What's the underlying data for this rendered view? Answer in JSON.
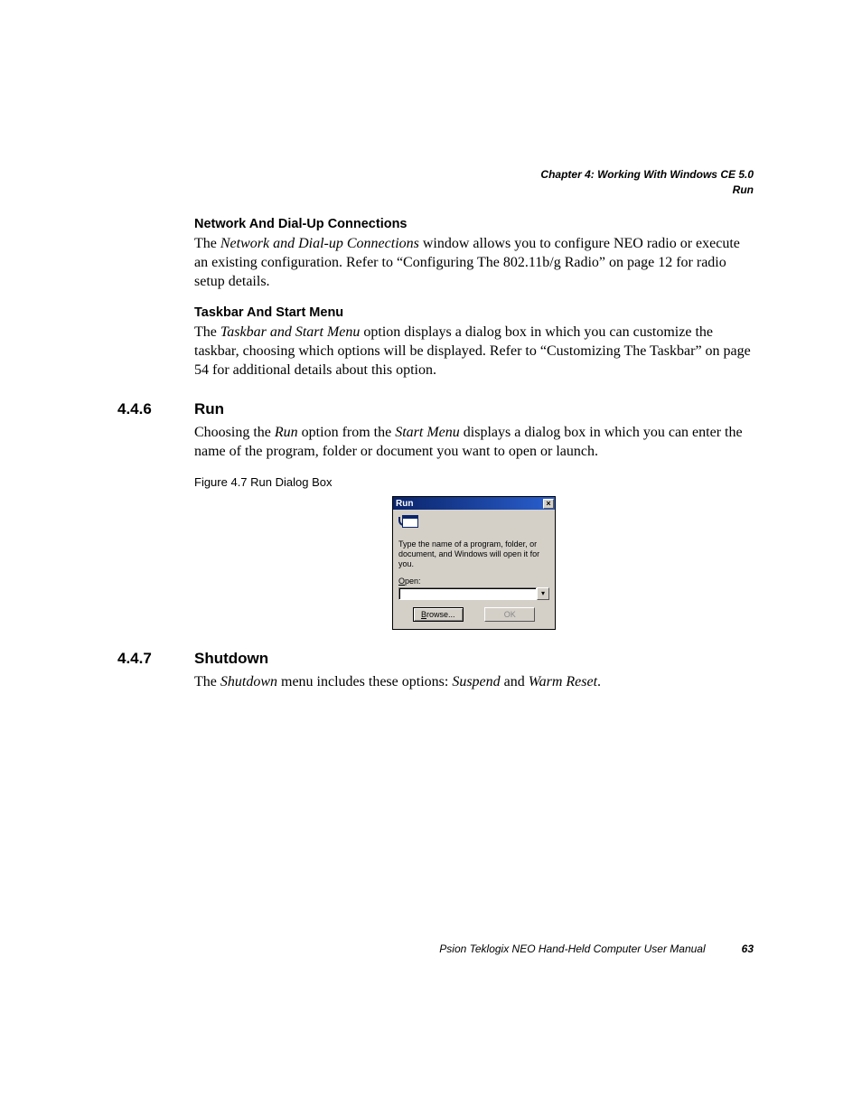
{
  "header": {
    "chapter_line": "Chapter 4: Working With Windows CE 5.0",
    "section_line": "Run"
  },
  "sub1": {
    "heading": "Network And Dial-Up Connections",
    "p_a": "The ",
    "p_b_em": "Network and Dial-up Connections",
    "p_c": " window allows you to configure NEO radio or execute an existing configuration. Refer to “Configuring The 802.11b/g Radio” on page 12 for radio setup details."
  },
  "sub2": {
    "heading": "Taskbar And Start Menu",
    "p_a": "The ",
    "p_b_em": "Taskbar and Start Menu",
    "p_c": " option displays a dialog box in which you can customize the taskbar, choosing which options will be displayed. Refer to “Customizing The Taskbar” on page 54 for additional details about this option."
  },
  "sec446": {
    "num": "4.4.6",
    "title": "Run",
    "p_a": "Choosing the ",
    "p_b_em": "Run",
    "p_c": " option from the ",
    "p_d_em": "Start Menu",
    "p_e": " displays a dialog box in which you can enter the name of the program, folder or document you want to open or launch.",
    "fig_caption": "Figure 4.7  Run Dialog Box"
  },
  "run_dialog": {
    "title": "Run",
    "close_glyph": "×",
    "instruction": "Type the name of a program, folder, or document, and Windows will open it for you.",
    "open_u": "O",
    "open_rest": "pen:",
    "dropdown_glyph": "▾",
    "browse_u": "B",
    "browse_rest": "rowse...",
    "ok": "OK"
  },
  "sec447": {
    "num": "4.4.7",
    "title": "Shutdown",
    "p_a": "The ",
    "p_b_em": "Shutdown",
    "p_c": " menu includes these options: ",
    "p_d_em": "Suspend",
    "p_e": " and ",
    "p_f_em": "Warm Reset",
    "p_g": "."
  },
  "footer": {
    "manual": "Psion Teklogix NEO Hand-Held Computer User Manual",
    "page": "63"
  }
}
